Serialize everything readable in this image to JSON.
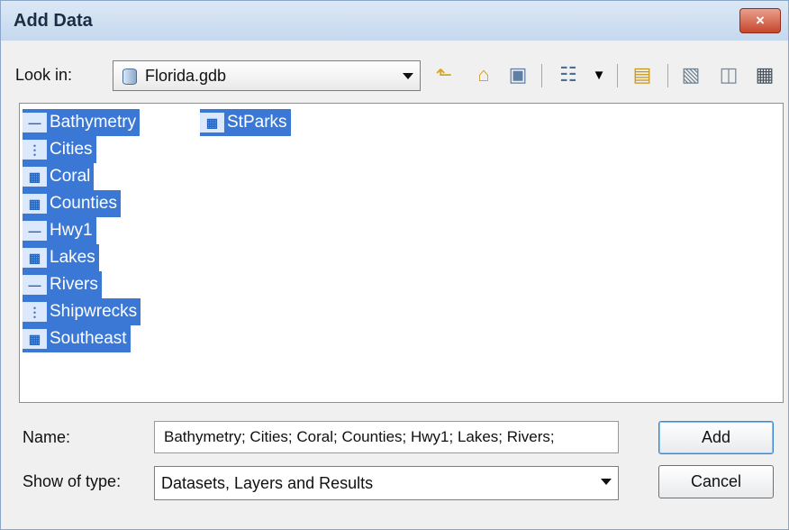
{
  "window": {
    "title": "Add Data",
    "close_label": "×"
  },
  "look_in": {
    "label": "Look in:",
    "value": "Florida.gdb"
  },
  "toolbar": {
    "icons": [
      "up-folder-icon",
      "home-icon",
      "connect-icon",
      "view-icon",
      "new-folder-icon",
      "database-icon",
      "catalog-icon",
      "toolbox-icon"
    ]
  },
  "items": [
    {
      "name": "Bathymetry",
      "icon": "line-feature-icon"
    },
    {
      "name": "Cities",
      "icon": "point-feature-icon"
    },
    {
      "name": "Coral",
      "icon": "polygon-feature-icon"
    },
    {
      "name": "Counties",
      "icon": "polygon-feature-icon"
    },
    {
      "name": "Hwy1",
      "icon": "line-feature-icon"
    },
    {
      "name": "Lakes",
      "icon": "polygon-feature-icon"
    },
    {
      "name": "Rivers",
      "icon": "line-feature-icon"
    },
    {
      "name": "Shipwrecks",
      "icon": "point-feature-icon"
    },
    {
      "name": "Southeast",
      "icon": "polygon-feature-icon"
    },
    {
      "name": "StParks",
      "icon": "polygon-feature-icon"
    }
  ],
  "name_field": {
    "label": "Name:",
    "value": "Bathymetry; Cities; Coral; Counties; Hwy1; Lakes; Rivers;"
  },
  "show_type": {
    "label": "Show of type:",
    "value": "Datasets, Layers and Results"
  },
  "buttons": {
    "add": "Add",
    "cancel": "Cancel"
  },
  "colors": {
    "selection": "#3b78d6",
    "title_bar": "#c5d8ee"
  }
}
